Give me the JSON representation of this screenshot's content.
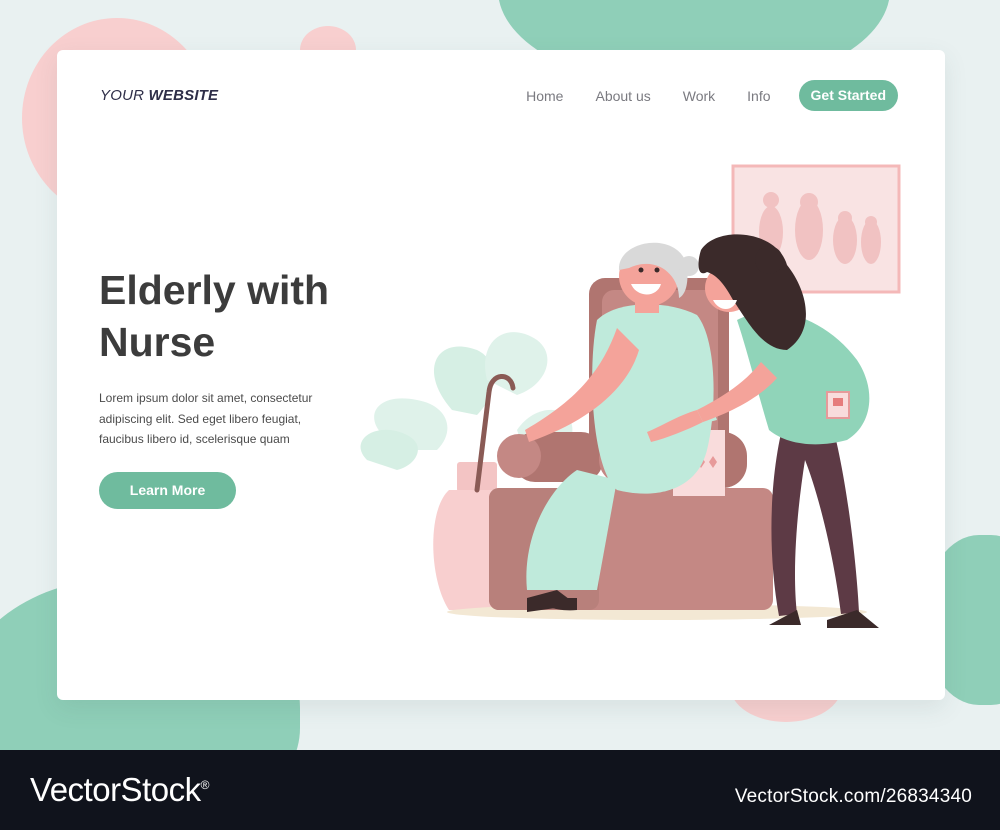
{
  "brand": {
    "logo_regular": "YOUR ",
    "logo_bold": "WEBSITE"
  },
  "nav": {
    "items": [
      "Home",
      "About us",
      "Work",
      "Info"
    ],
    "cta": "Get Started"
  },
  "hero": {
    "headline_line1": "Elderly with",
    "headline_line2": "Nurse",
    "body": "Lorem ipsum dolor sit amet, consectetur adipiscing elit. Sed eget libero feugiat, faucibus libero id, scelerisque quam",
    "button": "Learn More"
  },
  "illustration": {
    "subject": "nurse-with-elderly-woman-in-armchair"
  },
  "footer": {
    "brand": "VectorStock",
    "registered": "®",
    "url": "VectorStock.com/26834340"
  },
  "colors": {
    "accent": "#6fbb9e",
    "teal_blob": "#8fcfb8",
    "pink_blob": "#f8cfcf",
    "headline": "#3c3c3c",
    "footer_bg": "#10131c"
  }
}
